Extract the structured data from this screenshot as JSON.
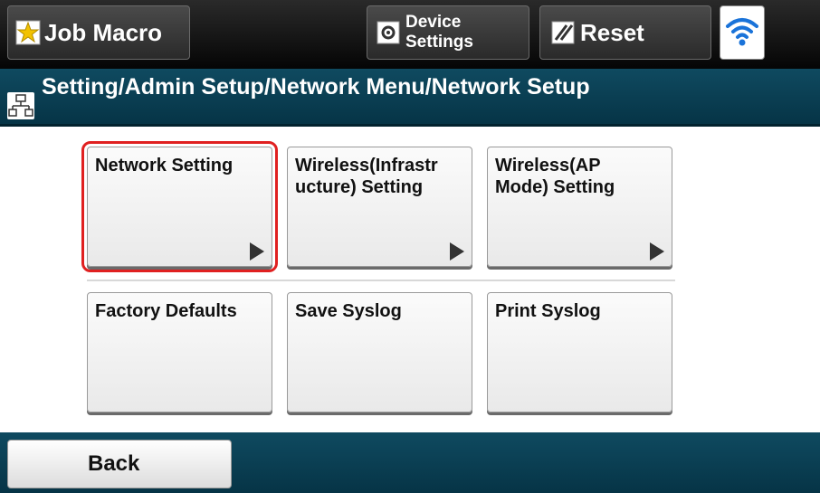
{
  "topbar": {
    "job_macro": "Job Macro",
    "device_settings_line1": "Device",
    "device_settings_line2": "Settings",
    "reset": "Reset"
  },
  "breadcrumb": {
    "path": "Setting/Admin Setup/Network Menu/Network Setup"
  },
  "menu": {
    "items": [
      {
        "label": "Network Setting",
        "selected": true,
        "has_arrow": true
      },
      {
        "label": "Wireless(Infrastructure) Setting",
        "display": "Wireless(Infrastr\nucture) Setting",
        "selected": false,
        "has_arrow": true
      },
      {
        "label": "Wireless(AP Mode) Setting",
        "display": "Wireless(AP\nMode) Setting",
        "selected": false,
        "has_arrow": true
      },
      {
        "label": "Factory Defaults",
        "selected": false,
        "has_arrow": false
      },
      {
        "label": "Save Syslog",
        "selected": false,
        "has_arrow": false
      },
      {
        "label": "Print Syslog",
        "selected": false,
        "has_arrow": false
      }
    ]
  },
  "bottom": {
    "back": "Back"
  },
  "colors": {
    "header_teal": "#0f4a60",
    "selection_red": "#e02020",
    "wifi_blue": "#1a73d9"
  }
}
